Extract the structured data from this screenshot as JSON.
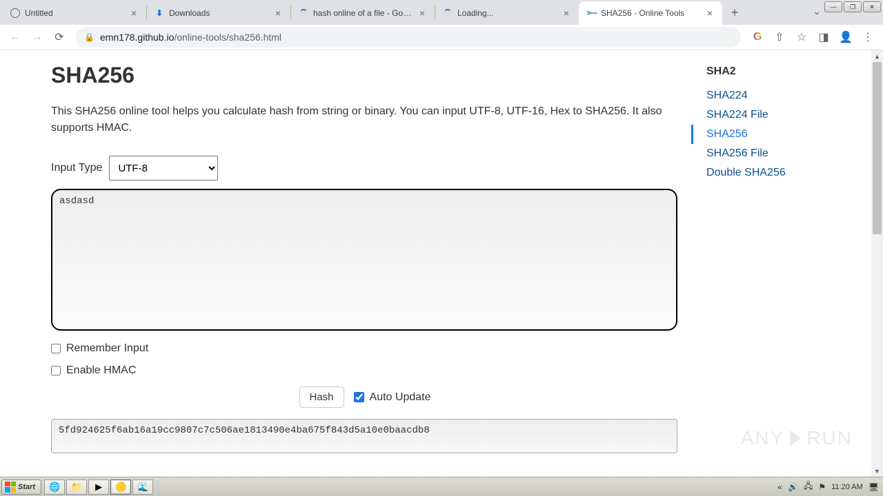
{
  "window": {
    "min": "—",
    "max": "❐",
    "close": "✕"
  },
  "tabs": [
    {
      "title": "Untitled",
      "favicon": "globe"
    },
    {
      "title": "Downloads",
      "favicon": "download"
    },
    {
      "title": "hash online of a file - Google S",
      "favicon": "spinner"
    },
    {
      "title": "Loading...",
      "favicon": "spinner"
    },
    {
      "title": "SHA256 - Online Tools",
      "favicon": "wrench",
      "active": true
    }
  ],
  "url": {
    "host": "emn178.github.io",
    "path": "/online-tools/sha256.html"
  },
  "page": {
    "heading": "SHA256",
    "description": "This SHA256 online tool helps you calculate hash from string or binary. You can input UTF-8, UTF-16, Hex to SHA256. It also supports HMAC.",
    "input_type_label": "Input Type",
    "input_type_value": "UTF-8",
    "input_value": "asdasd",
    "remember_label": "Remember Input",
    "hmac_label": "Enable HMAC",
    "hash_button": "Hash",
    "auto_update_label": "Auto Update",
    "auto_update_checked": true,
    "output_value": "5fd924625f6ab16a19cc9807c7c506ae1813490e4ba675f843d5a10e0baacdb8"
  },
  "sidebar": {
    "group": "SHA2",
    "items": [
      "SHA224",
      "SHA224 File",
      "SHA256",
      "SHA256 File",
      "Double SHA256"
    ],
    "active_index": 2
  },
  "watermark": {
    "left": "ANY",
    "right": "RUN"
  },
  "taskbar": {
    "start": "Start",
    "clock": "11:20 AM"
  }
}
